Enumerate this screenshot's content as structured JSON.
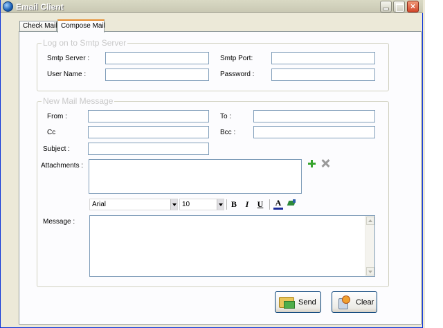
{
  "window": {
    "title": "Email Client"
  },
  "tabs": [
    {
      "label": "Check Mail"
    },
    {
      "label": "Compose Mail"
    }
  ],
  "smtp": {
    "group_title": "Log on to Smtp Server",
    "server_label": "Smtp Server :",
    "server_value": "",
    "port_label": "Smtp Port:",
    "port_value": "",
    "username_label": "User Name :",
    "username_value": "",
    "password_label": "Password :",
    "password_value": ""
  },
  "message": {
    "group_title": "New Mail Message",
    "from_label": "From :",
    "from_value": "",
    "to_label": "To :",
    "to_value": "",
    "cc_label": "Cc",
    "cc_value": "",
    "bcc_label": "Bcc :",
    "bcc_value": "",
    "subject_label": "Subject :",
    "subject_value": "",
    "attachments_label": "Attachments :",
    "message_label": "Message :",
    "body_value": ""
  },
  "toolbar": {
    "font_value": "Arial",
    "size_value": "10",
    "bold": "B",
    "italic": "I",
    "underline": "U",
    "font_color": "A"
  },
  "buttons": {
    "send_label": "Send",
    "clear_label": "Clear"
  },
  "icons": {
    "add_attachment": "plus-icon",
    "remove_attachment": "x-icon",
    "font_color": "font-color-icon",
    "highlight": "highlight-icon"
  },
  "colors": {
    "tab_accent": "#e68b2c",
    "add_green": "#37a52e",
    "group_title_gray": "#c8c8c8"
  }
}
